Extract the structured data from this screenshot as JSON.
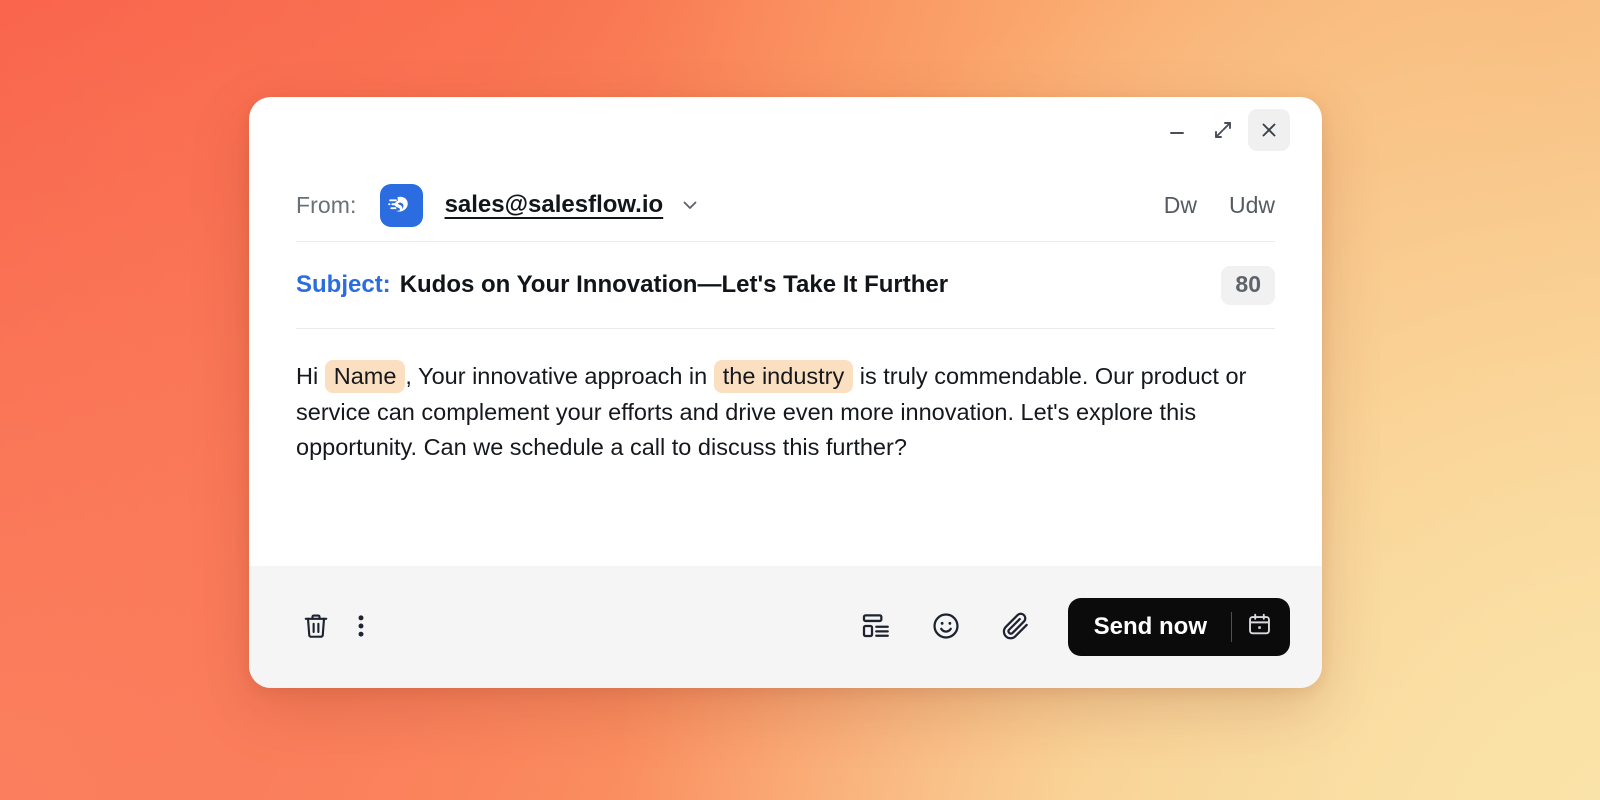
{
  "window": {
    "minimize_icon": "minimize-icon",
    "expand_icon": "expand-icon",
    "close_icon": "close-icon"
  },
  "from": {
    "label": "From:",
    "logo_icon": "salesflow-brand-icon",
    "address": "sales@salesflow.io",
    "chevron_icon": "chevron-down-icon",
    "cc_label": "Dw",
    "bcc_label": "Udw"
  },
  "subject": {
    "label": "Subject:",
    "value": "Kudos on Your Innovation—Let's Take It Further",
    "char_count": "80"
  },
  "body": {
    "segment_1": "Hi ",
    "token_1": "Name",
    "segment_2": ", Your innovative approach in ",
    "token_2": "the industry",
    "segment_3": " is truly commendable. Our product or service can complement your efforts and drive even more innovation. Let's explore this opportunity. Can we schedule a call to discuss this further?"
  },
  "toolbar": {
    "delete_icon": "trash-icon",
    "more_icon": "more-vertical-icon",
    "template_icon": "layout-template-icon",
    "emoji_icon": "smiley-icon",
    "attach_icon": "paperclip-icon",
    "send_label": "Send now",
    "schedule_icon": "calendar-icon"
  },
  "colors": {
    "accent_blue": "#2B6CE0",
    "token_highlight": "#FBDFC1",
    "send_button": "#0B0B0C",
    "footer_background": "#F5F5F5",
    "badge_background": "#F1F1F2",
    "gradient_top_left": "#F85C47",
    "gradient_top_right": "#F9B679",
    "gradient_bottom_left": "#FB7F5E",
    "gradient_bottom_right": "#FAE3A8"
  }
}
